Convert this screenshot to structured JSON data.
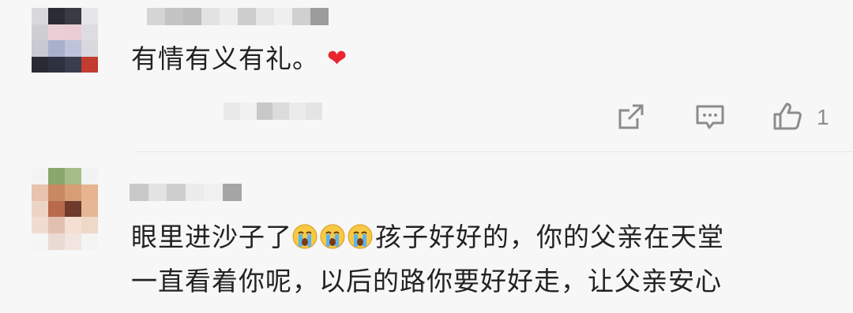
{
  "comments": [
    {
      "text": "有情有义有礼。",
      "emoji": "heart",
      "actions": {
        "share_icon": "share-icon",
        "reply_icon": "comment-icon",
        "like_icon": "thumbs-up-icon",
        "like_count": "1"
      }
    },
    {
      "text_prefix": "眼里进沙子了",
      "emoji": "crying-face",
      "emoji_count": 3,
      "text_suffix": "孩子好好的，你的父亲在天堂",
      "text_line2": "一直看着你呢，以后的路你要好好走，让父亲安心"
    }
  ],
  "colors": {
    "heart": "#e8262f",
    "text": "#222222",
    "icon": "#8c8c8c",
    "background": "#f7f7f7"
  }
}
